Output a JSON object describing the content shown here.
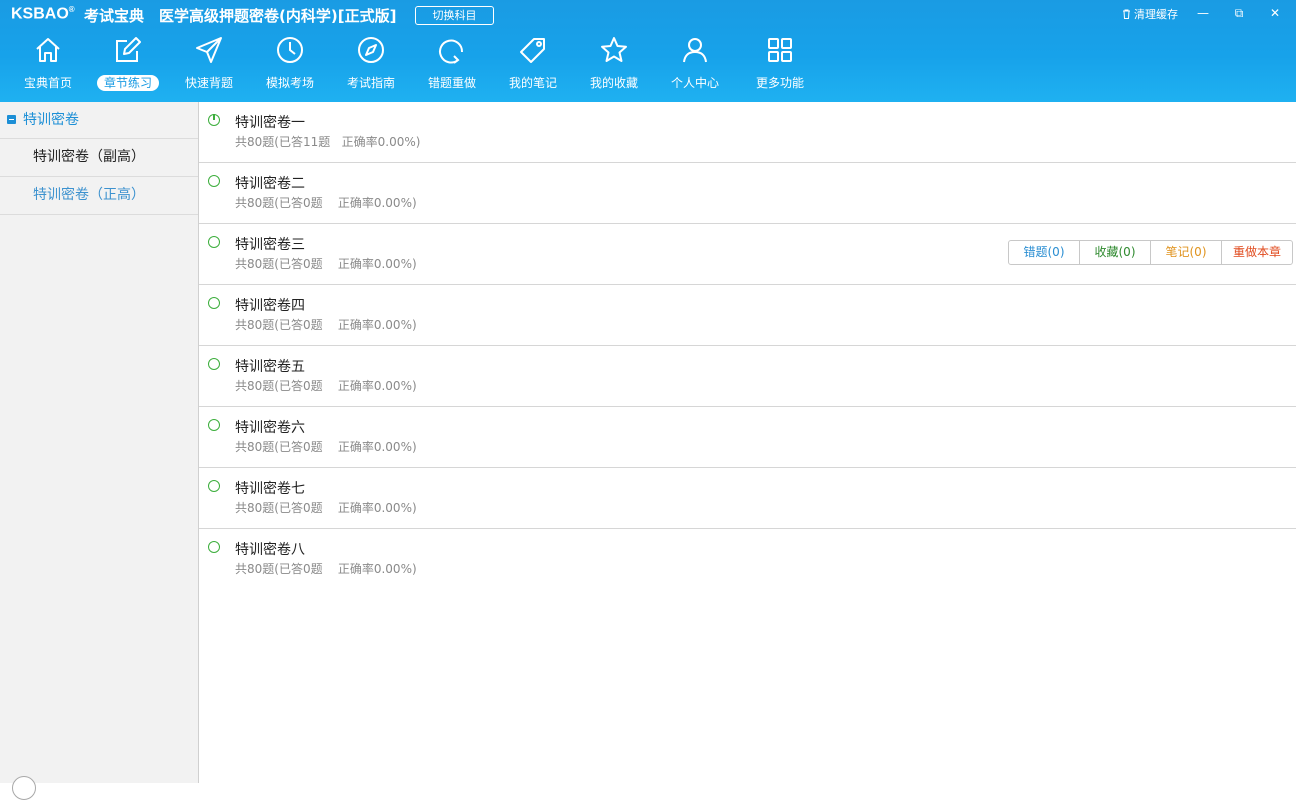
{
  "header": {
    "logo_en": "KSBAO",
    "logo_reg": "®",
    "logo_cn": "考试宝典",
    "app_title": "医学高级押题密卷(内科学)[正式版]",
    "switch_subject": "切换科目",
    "clear_cache": "清理缓存",
    "window_min": "—",
    "window_restore": "⧉",
    "window_close": "✕"
  },
  "nav": {
    "active_index": 1,
    "items": [
      {
        "label": "宝典首页",
        "icon": "home-icon"
      },
      {
        "label": "章节练习",
        "icon": "edit-icon"
      },
      {
        "label": "快速背题",
        "icon": "send-icon"
      },
      {
        "label": "模拟考场",
        "icon": "clock-icon"
      },
      {
        "label": "考试指南",
        "icon": "compass-icon"
      },
      {
        "label": "错题重做",
        "icon": "refresh-icon"
      },
      {
        "label": "我的笔记",
        "icon": "tag-icon"
      },
      {
        "label": "我的收藏",
        "icon": "star-icon"
      },
      {
        "label": "个人中心",
        "icon": "user-icon"
      },
      {
        "label": "更多功能",
        "icon": "grid-icon"
      }
    ]
  },
  "sidebar": {
    "group_label": "特训密卷",
    "items": [
      {
        "label": "特训密卷（副高）",
        "selected": false
      },
      {
        "label": "特训密卷（正高）",
        "selected": true
      }
    ]
  },
  "papers": {
    "items": [
      {
        "title": "特训密卷一",
        "meta": "共80题(已答11题   正确率0.00%)",
        "partial": true
      },
      {
        "title": "特训密卷二",
        "meta": "共80题(已答0题    正确率0.00%)",
        "partial": false
      },
      {
        "title": "特训密卷三",
        "meta": "共80题(已答0题    正确率0.00%)",
        "partial": false
      },
      {
        "title": "特训密卷四",
        "meta": "共80题(已答0题    正确率0.00%)",
        "partial": false
      },
      {
        "title": "特训密卷五",
        "meta": "共80题(已答0题    正确率0.00%)",
        "partial": false
      },
      {
        "title": "特训密卷六",
        "meta": "共80题(已答0题    正确率0.00%)",
        "partial": false
      },
      {
        "title": "特训密卷七",
        "meta": "共80题(已答0题    正确率0.00%)",
        "partial": false
      },
      {
        "title": "特训密卷八",
        "meta": "共80题(已答0题    正确率0.00%)",
        "partial": false
      }
    ],
    "actions": {
      "wrong": "错题(0)",
      "favorite": "收藏(0)",
      "notes": "笔记(0)",
      "redo": "重做本章"
    }
  },
  "colors": {
    "header_blue": "#1a9be3",
    "sidebar_selected": "#3d92cf",
    "status_green": "#3cae3c"
  }
}
